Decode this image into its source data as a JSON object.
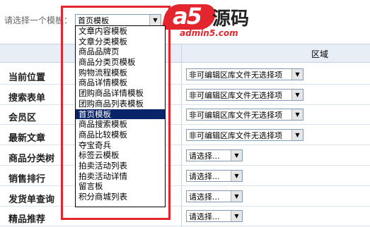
{
  "filter": {
    "label": "请选择一个模板：",
    "selected": "首页模板"
  },
  "dropdown_options": [
    "文章内容模板",
    "文章分类模板",
    "商品品牌页",
    "商品分类页模板",
    "购物流程模板",
    "商品详情模板",
    "团购商品详情模板",
    "团购商品列表模板",
    "首页模板",
    "商品搜索模板",
    "商品比较模板",
    "夺宝奇兵",
    "标签云模板",
    "拍卖活动列表",
    "拍卖活动详情",
    "留言板",
    "积分商城列表"
  ],
  "selected_option_index": 8,
  "table": {
    "column_area": "区域",
    "rows": [
      {
        "label": "当前位置",
        "value": "非可编辑区库文件无选择项"
      },
      {
        "label": "搜索表单",
        "value": "非可编辑区库文件无选择项"
      },
      {
        "label": "会员区",
        "value": "非可编辑区库文件无选择项"
      },
      {
        "label": "最新文章",
        "value": "非可编辑区库文件无选择项"
      },
      {
        "label": "商品分类树",
        "value": "请选择..."
      },
      {
        "label": "销售排行",
        "value": "请选择..."
      },
      {
        "label": "发货单查询",
        "value": "请选择..."
      },
      {
        "label": "精品推荐",
        "value": "请选择..."
      }
    ]
  },
  "watermark": {
    "logo_text": "a5",
    "logo_cn": "源码",
    "site": "admin5.com"
  },
  "colors": {
    "highlight_frame": "#e3262e",
    "selected_option_bg": "#0a246a",
    "header_bg": "#e8eef5"
  }
}
